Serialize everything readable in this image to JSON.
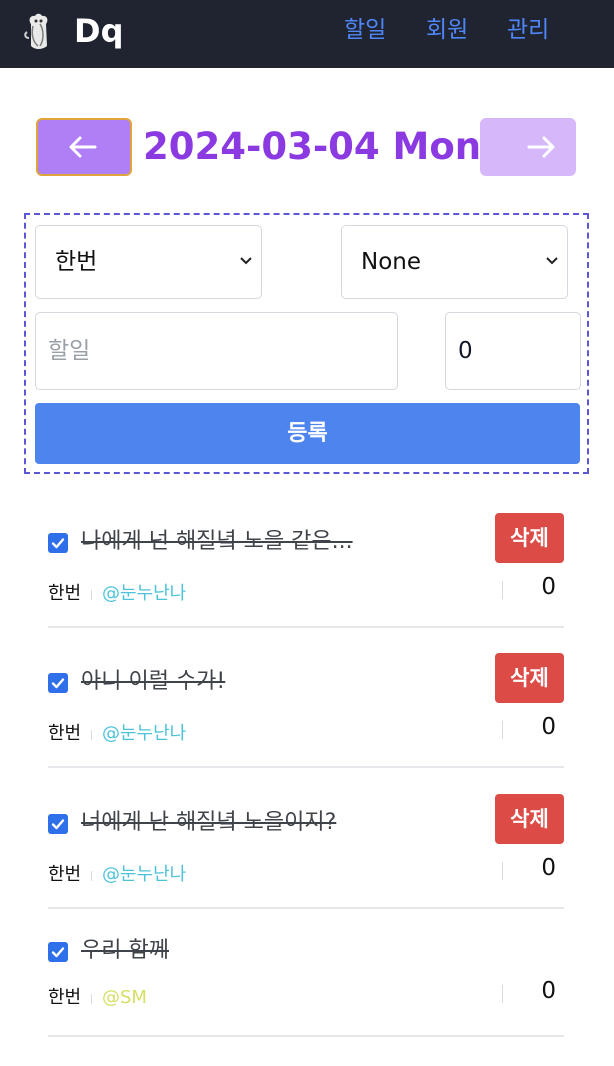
{
  "navbar": {
    "brand": "Dq",
    "links": [
      "할일",
      "회원",
      "관리"
    ]
  },
  "date_nav": {
    "prev_icon": "arrow-left-icon",
    "next_icon": "arrow-right-icon",
    "date": "2024-03-04 Mon"
  },
  "form": {
    "repeat_select": "한번",
    "target_select": "None",
    "task_placeholder": "할일",
    "points_value": "0",
    "submit_label": "등록"
  },
  "todos": [
    {
      "title": "나에게 넌 해질녘 노을 같은...",
      "frequency": "한번",
      "mention": "@눈누난나",
      "count": "0",
      "checked": true,
      "delete_label": "삭제",
      "mention_color": "#4dc3d9"
    },
    {
      "title": "아니 이럴 수가!",
      "frequency": "한번",
      "mention": "@눈누난나",
      "count": "0",
      "checked": true,
      "delete_label": "삭제",
      "mention_color": "#4dc3d9"
    },
    {
      "title": "너에게 난 해질녘 노을이지?",
      "frequency": "한번",
      "mention": "@눈누난나",
      "count": "0",
      "checked": true,
      "delete_label": "삭제",
      "mention_color": "#4dc3d9"
    },
    {
      "title": "우리 함께",
      "frequency": "한번",
      "mention": "@SM",
      "count": "0",
      "checked": true,
      "delete_label": null,
      "mention_color": "#d6df63"
    }
  ],
  "colors": {
    "navbar_bg": "#1f2430",
    "nav_link": "#4f86f7",
    "date_text": "#8a3ae0",
    "prev_button": "#b07ff5",
    "next_button": "#d6b8fa",
    "submit": "#4e84ee",
    "delete": "#dc4b45"
  }
}
